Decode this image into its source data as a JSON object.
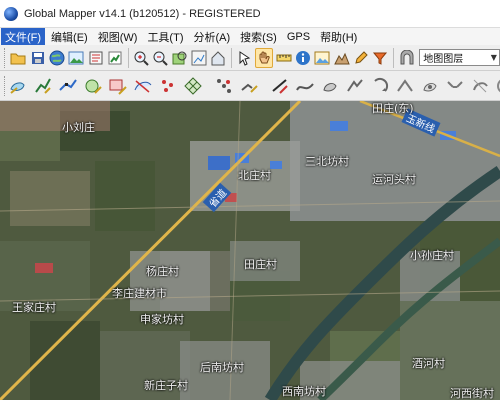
{
  "window": {
    "title": "Global Mapper v14.1 (b120512) - REGISTERED"
  },
  "menubar": {
    "items": [
      {
        "label": "文件(F)"
      },
      {
        "label": "编辑(E)"
      },
      {
        "label": "视图(W)"
      },
      {
        "label": "工具(T)"
      },
      {
        "label": "分析(A)"
      },
      {
        "label": "搜索(S)"
      },
      {
        "label": "GPS"
      },
      {
        "label": "帮助(H)"
      }
    ]
  },
  "toolbar": {
    "map_layer_select": {
      "value": "地图图层"
    }
  },
  "map": {
    "labels": [
      {
        "text": "小刘庄"
      },
      {
        "text": "北庄村"
      },
      {
        "text": "三北坊村"
      },
      {
        "text": "运河头村"
      },
      {
        "text": "杨庄村"
      },
      {
        "text": "田庄村"
      },
      {
        "text": "小孙庄村"
      },
      {
        "text": "李庄建材市"
      },
      {
        "text": "王家庄村"
      },
      {
        "text": "申家坊村"
      },
      {
        "text": "后南坊村"
      },
      {
        "text": "新庄子村"
      },
      {
        "text": "西南坊村"
      },
      {
        "text": "酒河村"
      },
      {
        "text": "河西街村"
      },
      {
        "text": "田庄(东)"
      }
    ],
    "road_labels": [
      {
        "text": "玉新线"
      },
      {
        "text": "省道"
      }
    ]
  }
}
